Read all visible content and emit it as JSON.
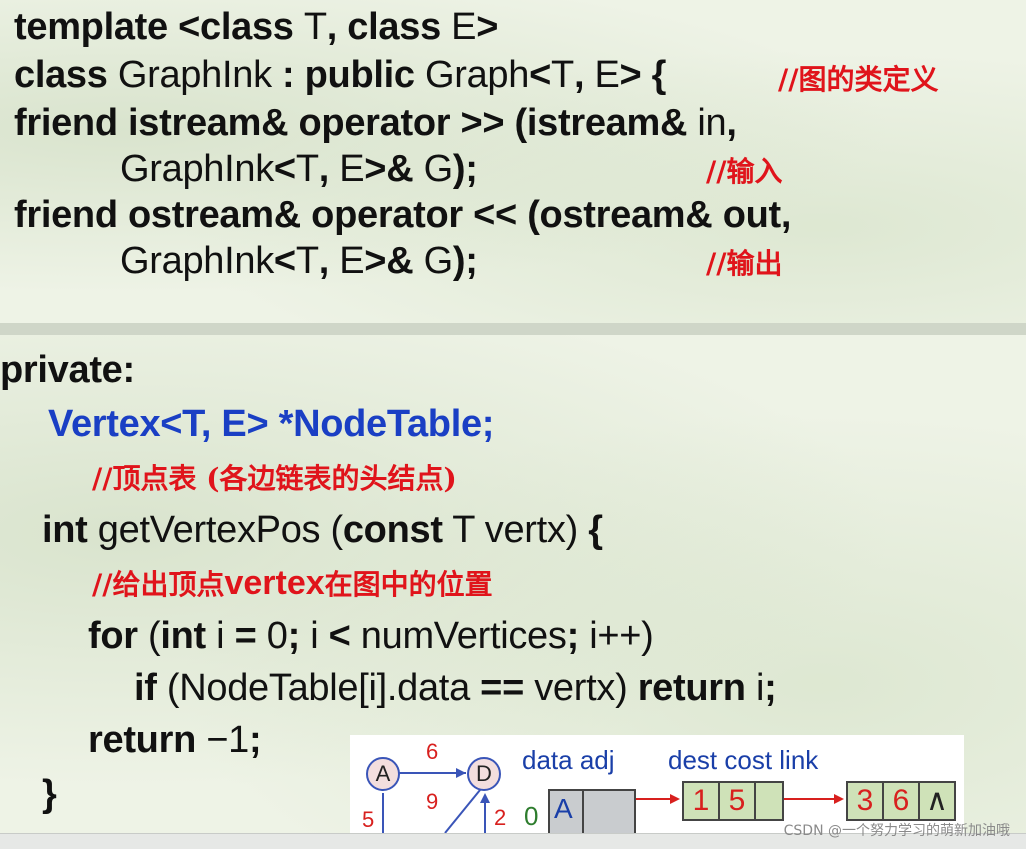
{
  "code_top": {
    "line1": [
      "template <class ",
      "T",
      ", class ",
      "E",
      ">"
    ],
    "line2": [
      "class ",
      "GraphInk",
      " : public ",
      "Graph",
      "<",
      "T",
      ", ",
      "E",
      "> {"
    ],
    "line3": [
      "friend istream& operator >> (istream& ",
      "in",
      ","
    ],
    "line4": [
      "GraphInk",
      "<",
      "T",
      ", ",
      "E",
      ">& ",
      "G",
      ");"
    ],
    "line5": [
      "friend ostream& operator << (ostream& out,"
    ],
    "line6": [
      "GraphInk",
      "<",
      "T",
      ", ",
      "E",
      ">& ",
      "G",
      ");"
    ]
  },
  "comments_top": {
    "c1": "//图的类定义",
    "c2": "//输入",
    "c3": "//输出"
  },
  "code_bottom": {
    "private": "private:",
    "vertex_decl": "Vertex<T, E> *NodeTable;",
    "c_table": "//顶点表 (各边链表的头结点)",
    "getpos": [
      "int",
      " getVertexPos (",
      "const",
      " T vertx) ",
      "{"
    ],
    "c_getpos": [
      "//给出顶点",
      "vertex",
      "在图中的位置"
    ],
    "for": [
      "for",
      " (",
      "int",
      " i ",
      "=",
      " 0",
      ";",
      " i ",
      "<",
      " numVertices",
      ";",
      " i++)"
    ],
    "if": [
      "if",
      " (NodeTable[i].data ",
      "==",
      " vertx) ",
      "return",
      " i",
      ";"
    ],
    "return": [
      "return",
      " −1",
      ";"
    ],
    "close": "}"
  },
  "diagram": {
    "header_left": "data adj",
    "header_right": "dest cost link",
    "node_a": "A",
    "node_d": "D",
    "edge_ad": "6",
    "edge_left": "5",
    "edge_diag": "9",
    "edge_right": "2",
    "row_index": "0",
    "row_data": "A",
    "cell1_dest": "1",
    "cell1_cost": "5",
    "cell2_dest": "3",
    "cell2_cost": "6",
    "cell2_link": "∧"
  },
  "watermark": "CSDN @一个努力学习的萌新加油哦"
}
